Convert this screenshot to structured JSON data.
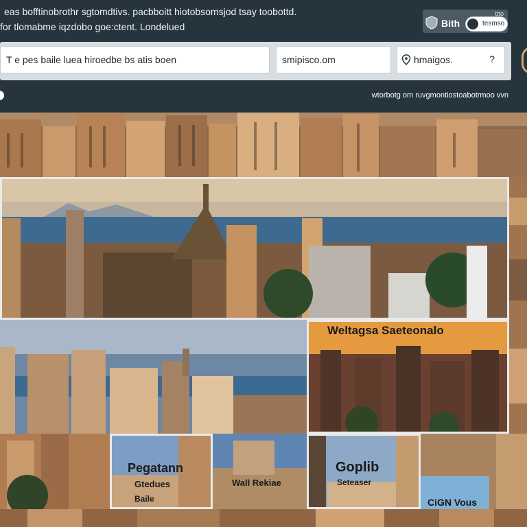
{
  "header": {
    "intro_line_1": "eas bofftinobrothr sgtomdtivs. pacbboitt hiotobsomsjod tsay toobottd.",
    "intro_line_2": "for tlomabme iqzdobo goe:ctent. Londelued",
    "badge_small_text": "ttto",
    "badge_label": "Bith",
    "toggle_label": "tesmso",
    "status_text": "wtorbotg om ruvgmontiostoabotrmoo vvn"
  },
  "search": {
    "query_value": "T e pes baile luea hiroedbe bs atis boen",
    "second_value": "smipisco.om",
    "location_value": "hmaigos.",
    "help_symbol": "?"
  },
  "icons": {
    "badge": "shield-icon",
    "location": "map-pin-icon",
    "help": "question-mark-icon"
  },
  "gallery": {
    "captions": [
      "Weltagsa Saeteonalo",
      "Pegatann",
      "Gtedues",
      "Baile",
      "Wall Rekiae",
      "Goplib",
      "Seteaser",
      "CiGN Vous"
    ]
  },
  "colors": {
    "header_bg": "#26343d",
    "panel_bg": "#d7dde1",
    "accent_gold": "#c9a86a"
  }
}
